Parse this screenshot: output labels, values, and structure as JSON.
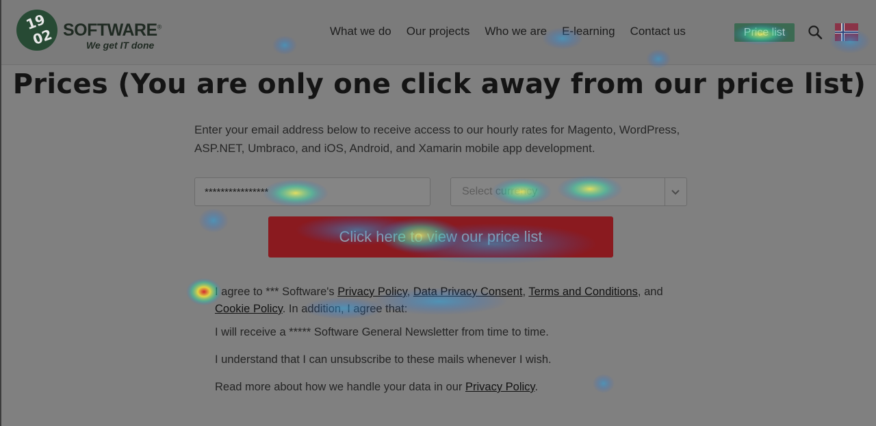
{
  "header": {
    "logo": {
      "mark": "1902",
      "word": "SOFTWARE",
      "registered": "®",
      "tagline": "We get IT done"
    },
    "nav": [
      "What we do",
      "Our projects",
      "Who we are",
      "E-learning",
      "Contact us"
    ],
    "price_list_label": "Price list",
    "search_icon": "search-icon",
    "flag_icon": "danish-flag-icon"
  },
  "main": {
    "title": "Prices (You are only one click away from our price list)",
    "intro": "Enter your email address below to receive access to our hourly rates for Magento, WordPress, ASP.NET, Umbraco, and iOS, Android, and Xamarin mobile app development.",
    "email_value": "****************",
    "currency_placeholder": "Select currency",
    "cta_label": "Click here to view our price list",
    "terms": {
      "prefix": "I agree to *** Software's ",
      "privacy_policy": "Privacy Policy",
      "sep1": ", ",
      "data_privacy": "Data Privacy Consent",
      "sep2": ", ",
      "terms_conditions": "Terms and Conditions",
      "sep3": ", and ",
      "cookie_policy": "Cookie Policy",
      "suffix": ". In addition, I agree that:"
    },
    "newsletter_text": "I will receive a ***** Software General Newsletter from time to time.",
    "unsubscribe_text": "I understand that I can unsubscribe to these mails whenever I wish.",
    "read_more_prefix": "Read more about how we handle your data in our ",
    "read_more_link": "Privacy Policy",
    "read_more_suffix": "."
  },
  "colors": {
    "cta_background": "#8a1a1f",
    "logo_green": "#274a34",
    "price_pill": "#3b6a52"
  }
}
